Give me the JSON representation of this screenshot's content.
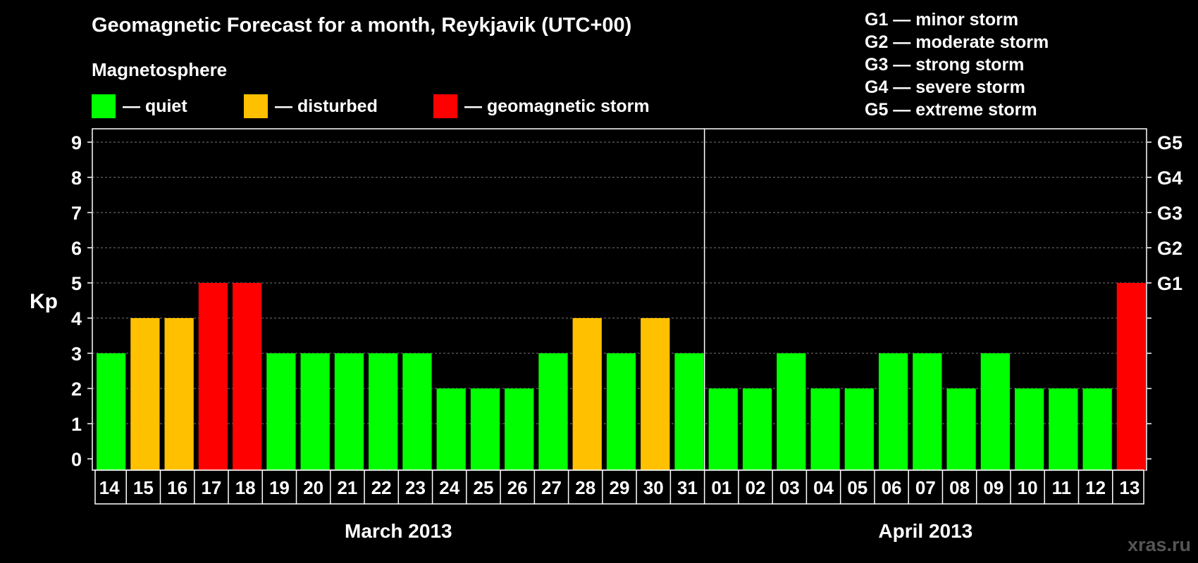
{
  "title": "Geomagnetic Forecast for a month, Reykjavik (UTC+00)",
  "subtitle": "Magnetosphere",
  "legend": [
    {
      "label": "— quiet",
      "color": "#00ff00"
    },
    {
      "label": "— disturbed",
      "color": "#ffc000"
    },
    {
      "label": "— geomagnetic storm",
      "color": "#ff0000"
    }
  ],
  "g_scale": [
    "G1 — minor storm",
    "G2 — moderate storm",
    "G3 — strong storm",
    "G4 — severe storm",
    "G5 — extreme storm"
  ],
  "watermark": "xras.ru",
  "chart_data": {
    "type": "bar",
    "ylabel": "Kp",
    "ylim": [
      0,
      9
    ],
    "yticks": [
      "0",
      "1",
      "2",
      "3",
      "4",
      "5",
      "6",
      "7",
      "8",
      "9"
    ],
    "right_ticks": [
      {
        "value": 5,
        "label": "G1"
      },
      {
        "value": 6,
        "label": "G2"
      },
      {
        "value": 7,
        "label": "G3"
      },
      {
        "value": 8,
        "label": "G4"
      },
      {
        "value": 9,
        "label": "G5"
      }
    ],
    "grid": "dashed horizontal",
    "categories": [
      "14",
      "15",
      "16",
      "17",
      "18",
      "19",
      "20",
      "21",
      "22",
      "23",
      "24",
      "25",
      "26",
      "27",
      "28",
      "29",
      "30",
      "31",
      "01",
      "02",
      "03",
      "04",
      "05",
      "06",
      "07",
      "08",
      "09",
      "10",
      "11",
      "12",
      "13"
    ],
    "values": [
      3,
      4,
      4,
      5,
      5,
      3,
      3,
      3,
      3,
      3,
      2,
      2,
      2,
      3,
      4,
      3,
      4,
      3,
      2,
      2,
      3,
      2,
      2,
      3,
      3,
      2,
      3,
      2,
      2,
      2,
      5
    ],
    "colors": {
      "quiet": "#00ff00",
      "disturbed": "#ffc000",
      "storm": "#ff0000"
    },
    "months": [
      {
        "label": "March 2013",
        "count": 18
      },
      {
        "label": "April 2013",
        "count": 13
      }
    ]
  }
}
